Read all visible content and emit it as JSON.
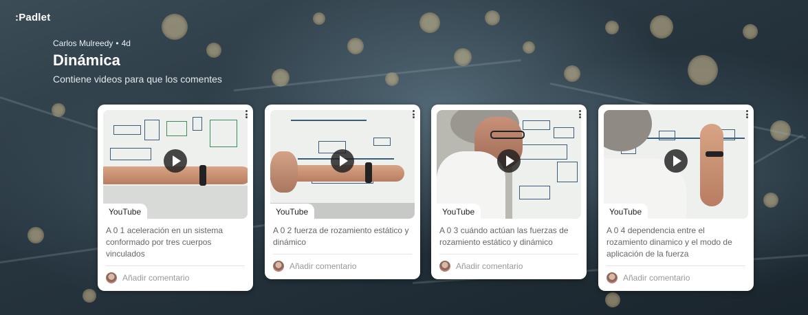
{
  "app": {
    "logo": ":Padlet"
  },
  "board": {
    "author": "Carlos Mulreedy",
    "separator": "•",
    "age": "4d",
    "title": "Dinámica",
    "description": "Contiene videos para que los comentes"
  },
  "posts": [
    {
      "source": "YouTube",
      "caption": "A 0 1 aceleración en un sistema conformado por tres cuerpos vinculados",
      "comment_placeholder": "Añadir comentario"
    },
    {
      "source": "YouTube",
      "caption": "A 0 2 fuerza de rozamiento estático y dinámico",
      "comment_placeholder": "Añadir comentario"
    },
    {
      "source": "YouTube",
      "caption": "A 0 3 cuándo actúan las fuerzas de rozamiento estático y dinámico",
      "comment_placeholder": "Añadir comentario"
    },
    {
      "source": "YouTube",
      "caption": "A 0 4 dependencia entre el rozamiento dinamico y el modo de aplicación de la fuerza",
      "comment_placeholder": "Añadir comentario"
    }
  ],
  "icons": {
    "play": "play-icon",
    "menu": "more-vertical-icon",
    "avatar": "user-avatar"
  }
}
